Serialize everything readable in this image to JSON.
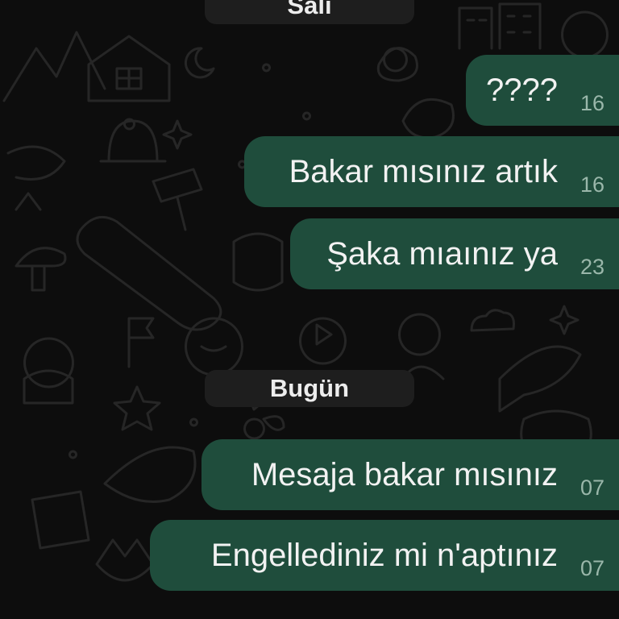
{
  "chat": {
    "date_separators": [
      "Salı",
      "Bugün"
    ],
    "messages": [
      {
        "text": "????",
        "time": "16"
      },
      {
        "text": "Bakar mısınız artık",
        "time": "16"
      },
      {
        "text": "Şaka mıaınız ya",
        "time": "23"
      },
      {
        "text": "Mesaja bakar mısınız",
        "time": "07"
      },
      {
        "text": "Engellediniz mi n'aptınız",
        "time": "07"
      }
    ]
  },
  "colors": {
    "background": "#0d0d0d",
    "outgoing_bubble": "#1f4d3c",
    "date_chip": "#1e1e1e",
    "wallpaper_doodle": "#262626"
  }
}
